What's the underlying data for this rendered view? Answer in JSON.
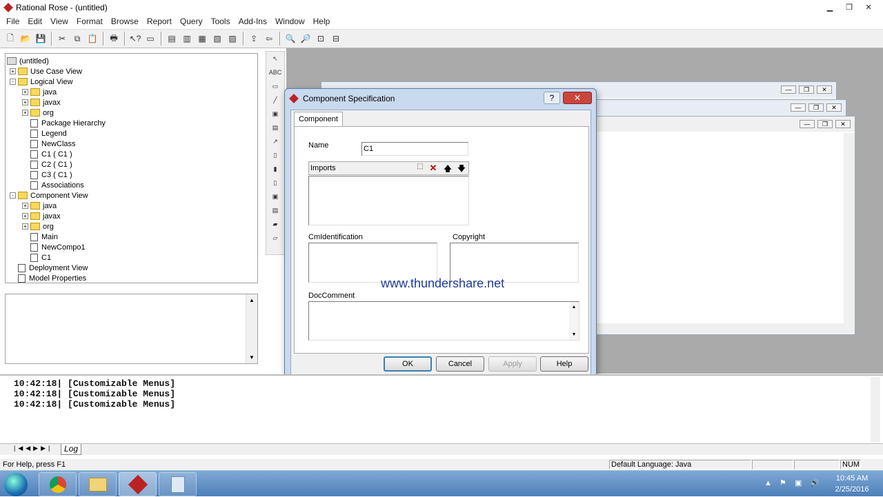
{
  "window": {
    "title": "Rational Rose - (untitled)"
  },
  "menu": [
    "File",
    "Edit",
    "View",
    "Format",
    "Browse",
    "Report",
    "Query",
    "Tools",
    "Add-Ins",
    "Window",
    "Help"
  ],
  "tree": {
    "root": "(untitled)",
    "items": [
      {
        "label": "Use Case View",
        "depth": 1,
        "kind": "folder",
        "expander": "+"
      },
      {
        "label": "Logical View",
        "depth": 1,
        "kind": "folder",
        "expander": "-"
      },
      {
        "label": "java",
        "depth": 2,
        "kind": "folder",
        "expander": "+"
      },
      {
        "label": "javax",
        "depth": 2,
        "kind": "folder",
        "expander": "+"
      },
      {
        "label": "org",
        "depth": 2,
        "kind": "folder",
        "expander": "+"
      },
      {
        "label": "Package Hierarchy",
        "depth": 2,
        "kind": "doc",
        "expander": ""
      },
      {
        "label": "Legend",
        "depth": 2,
        "kind": "doc",
        "expander": ""
      },
      {
        "label": "NewClass",
        "depth": 2,
        "kind": "doc",
        "expander": ""
      },
      {
        "label": "C1 ( C1 )",
        "depth": 2,
        "kind": "doc",
        "expander": ""
      },
      {
        "label": "C2 ( C1 )",
        "depth": 2,
        "kind": "doc",
        "expander": ""
      },
      {
        "label": "C3 ( C1 )",
        "depth": 2,
        "kind": "doc",
        "expander": ""
      },
      {
        "label": "Associations",
        "depth": 2,
        "kind": "doc",
        "expander": ""
      },
      {
        "label": "Component View",
        "depth": 1,
        "kind": "folder",
        "expander": "-"
      },
      {
        "label": "java",
        "depth": 2,
        "kind": "folder",
        "expander": "+"
      },
      {
        "label": "javax",
        "depth": 2,
        "kind": "folder",
        "expander": "+"
      },
      {
        "label": "org",
        "depth": 2,
        "kind": "folder",
        "expander": "+"
      },
      {
        "label": "Main",
        "depth": 2,
        "kind": "doc",
        "expander": ""
      },
      {
        "label": "NewCompo1",
        "depth": 2,
        "kind": "doc",
        "expander": ""
      },
      {
        "label": "C1",
        "depth": 2,
        "kind": "doc",
        "expander": ""
      },
      {
        "label": "Deployment View",
        "depth": 1,
        "kind": "doc",
        "expander": ""
      },
      {
        "label": "Model Properties",
        "depth": 1,
        "kind": "doc",
        "expander": ""
      }
    ]
  },
  "dialog": {
    "title": "Component Specification",
    "tab": "Component",
    "name_label": "Name",
    "name_value": "C1",
    "imports_label": "Imports",
    "cm_label": "CmIdentification",
    "copyright_label": "Copyright",
    "doc_label": "DocComment",
    "watermark": "www.thundershare.net",
    "buttons": {
      "ok": "OK",
      "cancel": "Cancel",
      "apply": "Apply",
      "help": "Help"
    }
  },
  "log": {
    "lines": [
      "10:42:18|  [Customizable Menus]",
      "10:42:18|  [Customizable Menus]",
      "10:42:18|  [Customizable Menus]"
    ],
    "tab": "Log"
  },
  "status": {
    "help": "For Help, press F1",
    "language": "Default Language: Java",
    "num": "NUM"
  },
  "clock": {
    "time": "10:45 AM",
    "date": "2/25/2016"
  }
}
